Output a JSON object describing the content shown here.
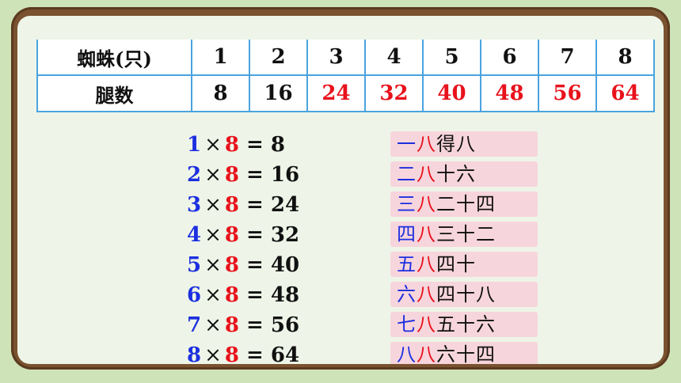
{
  "table": {
    "row1_header": "蜘蛛(只)",
    "row2_header": "腿数",
    "spiders": [
      "1",
      "2",
      "3",
      "4",
      "5",
      "6",
      "7",
      "8"
    ],
    "legs": [
      "8",
      "16",
      "24",
      "32",
      "40",
      "48",
      "56",
      "64"
    ]
  },
  "equations": [
    {
      "a": "1",
      "x": "×",
      "b": "8",
      "result": "= 8"
    },
    {
      "a": "2",
      "x": "×",
      "b": "8",
      "result": "= 16"
    },
    {
      "a": "3",
      "x": "×",
      "b": "8",
      "result": "= 24"
    },
    {
      "a": "4",
      "x": "×",
      "b": "8",
      "result": "= 32"
    },
    {
      "a": "5",
      "x": "×",
      "b": "8",
      "result": "= 40"
    },
    {
      "a": "6",
      "x": "×",
      "b": "8",
      "result": "= 48"
    },
    {
      "a": "7",
      "x": "×",
      "b": "8",
      "result": "= 56"
    },
    {
      "a": "8",
      "x": "×",
      "b": "8",
      "result": "= 64"
    }
  ],
  "rhymes": [
    {
      "p1": "一",
      "p2": "八",
      "p3": "得八"
    },
    {
      "p1": "二",
      "p2": "八",
      "p3": "十六"
    },
    {
      "p1": "三",
      "p2": "八",
      "p3": "二十四"
    },
    {
      "p1": "四",
      "p2": "八",
      "p3": "三十二"
    },
    {
      "p1": "五",
      "p2": "八",
      "p3": "四十"
    },
    {
      "p1": "六",
      "p2": "八",
      "p3": "四十八"
    },
    {
      "p1": "七",
      "p2": "八",
      "p3": "五十六"
    },
    {
      "p1": "八",
      "p2": "八",
      "p3": "六十四"
    }
  ],
  "colors": {
    "factor_blue": "#1c2fe0",
    "factor_red": "#e8121c",
    "table_border": "#4aa3df",
    "rhyme_bg": "#f7d5dc",
    "frame": "#7a5230"
  }
}
